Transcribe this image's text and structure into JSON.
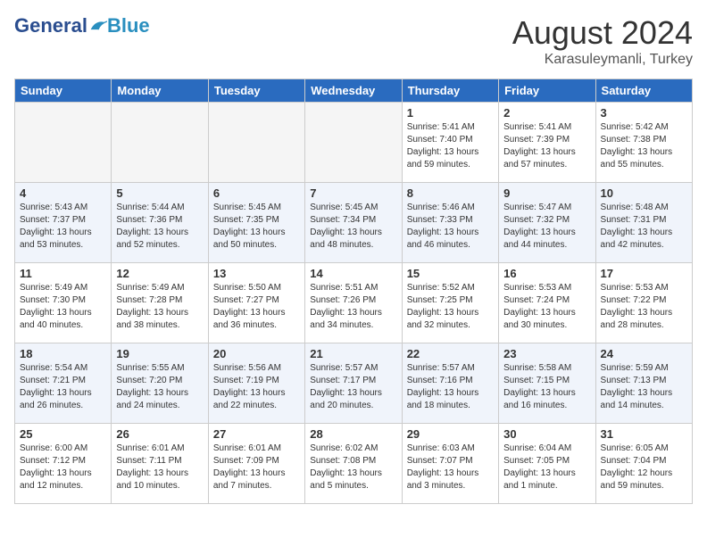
{
  "header": {
    "logo_general": "General",
    "logo_blue": "Blue",
    "month_year": "August 2024",
    "location": "Karasuleymanli, Turkey"
  },
  "days_of_week": [
    "Sunday",
    "Monday",
    "Tuesday",
    "Wednesday",
    "Thursday",
    "Friday",
    "Saturday"
  ],
  "weeks": [
    [
      {
        "num": "",
        "info": ""
      },
      {
        "num": "",
        "info": ""
      },
      {
        "num": "",
        "info": ""
      },
      {
        "num": "",
        "info": ""
      },
      {
        "num": "1",
        "info": "Sunrise: 5:41 AM\nSunset: 7:40 PM\nDaylight: 13 hours\nand 59 minutes."
      },
      {
        "num": "2",
        "info": "Sunrise: 5:41 AM\nSunset: 7:39 PM\nDaylight: 13 hours\nand 57 minutes."
      },
      {
        "num": "3",
        "info": "Sunrise: 5:42 AM\nSunset: 7:38 PM\nDaylight: 13 hours\nand 55 minutes."
      }
    ],
    [
      {
        "num": "4",
        "info": "Sunrise: 5:43 AM\nSunset: 7:37 PM\nDaylight: 13 hours\nand 53 minutes."
      },
      {
        "num": "5",
        "info": "Sunrise: 5:44 AM\nSunset: 7:36 PM\nDaylight: 13 hours\nand 52 minutes."
      },
      {
        "num": "6",
        "info": "Sunrise: 5:45 AM\nSunset: 7:35 PM\nDaylight: 13 hours\nand 50 minutes."
      },
      {
        "num": "7",
        "info": "Sunrise: 5:45 AM\nSunset: 7:34 PM\nDaylight: 13 hours\nand 48 minutes."
      },
      {
        "num": "8",
        "info": "Sunrise: 5:46 AM\nSunset: 7:33 PM\nDaylight: 13 hours\nand 46 minutes."
      },
      {
        "num": "9",
        "info": "Sunrise: 5:47 AM\nSunset: 7:32 PM\nDaylight: 13 hours\nand 44 minutes."
      },
      {
        "num": "10",
        "info": "Sunrise: 5:48 AM\nSunset: 7:31 PM\nDaylight: 13 hours\nand 42 minutes."
      }
    ],
    [
      {
        "num": "11",
        "info": "Sunrise: 5:49 AM\nSunset: 7:30 PM\nDaylight: 13 hours\nand 40 minutes."
      },
      {
        "num": "12",
        "info": "Sunrise: 5:49 AM\nSunset: 7:28 PM\nDaylight: 13 hours\nand 38 minutes."
      },
      {
        "num": "13",
        "info": "Sunrise: 5:50 AM\nSunset: 7:27 PM\nDaylight: 13 hours\nand 36 minutes."
      },
      {
        "num": "14",
        "info": "Sunrise: 5:51 AM\nSunset: 7:26 PM\nDaylight: 13 hours\nand 34 minutes."
      },
      {
        "num": "15",
        "info": "Sunrise: 5:52 AM\nSunset: 7:25 PM\nDaylight: 13 hours\nand 32 minutes."
      },
      {
        "num": "16",
        "info": "Sunrise: 5:53 AM\nSunset: 7:24 PM\nDaylight: 13 hours\nand 30 minutes."
      },
      {
        "num": "17",
        "info": "Sunrise: 5:53 AM\nSunset: 7:22 PM\nDaylight: 13 hours\nand 28 minutes."
      }
    ],
    [
      {
        "num": "18",
        "info": "Sunrise: 5:54 AM\nSunset: 7:21 PM\nDaylight: 13 hours\nand 26 minutes."
      },
      {
        "num": "19",
        "info": "Sunrise: 5:55 AM\nSunset: 7:20 PM\nDaylight: 13 hours\nand 24 minutes."
      },
      {
        "num": "20",
        "info": "Sunrise: 5:56 AM\nSunset: 7:19 PM\nDaylight: 13 hours\nand 22 minutes."
      },
      {
        "num": "21",
        "info": "Sunrise: 5:57 AM\nSunset: 7:17 PM\nDaylight: 13 hours\nand 20 minutes."
      },
      {
        "num": "22",
        "info": "Sunrise: 5:57 AM\nSunset: 7:16 PM\nDaylight: 13 hours\nand 18 minutes."
      },
      {
        "num": "23",
        "info": "Sunrise: 5:58 AM\nSunset: 7:15 PM\nDaylight: 13 hours\nand 16 minutes."
      },
      {
        "num": "24",
        "info": "Sunrise: 5:59 AM\nSunset: 7:13 PM\nDaylight: 13 hours\nand 14 minutes."
      }
    ],
    [
      {
        "num": "25",
        "info": "Sunrise: 6:00 AM\nSunset: 7:12 PM\nDaylight: 13 hours\nand 12 minutes."
      },
      {
        "num": "26",
        "info": "Sunrise: 6:01 AM\nSunset: 7:11 PM\nDaylight: 13 hours\nand 10 minutes."
      },
      {
        "num": "27",
        "info": "Sunrise: 6:01 AM\nSunset: 7:09 PM\nDaylight: 13 hours\nand 7 minutes."
      },
      {
        "num": "28",
        "info": "Sunrise: 6:02 AM\nSunset: 7:08 PM\nDaylight: 13 hours\nand 5 minutes."
      },
      {
        "num": "29",
        "info": "Sunrise: 6:03 AM\nSunset: 7:07 PM\nDaylight: 13 hours\nand 3 minutes."
      },
      {
        "num": "30",
        "info": "Sunrise: 6:04 AM\nSunset: 7:05 PM\nDaylight: 13 hours\nand 1 minute."
      },
      {
        "num": "31",
        "info": "Sunrise: 6:05 AM\nSunset: 7:04 PM\nDaylight: 12 hours\nand 59 minutes."
      }
    ]
  ]
}
